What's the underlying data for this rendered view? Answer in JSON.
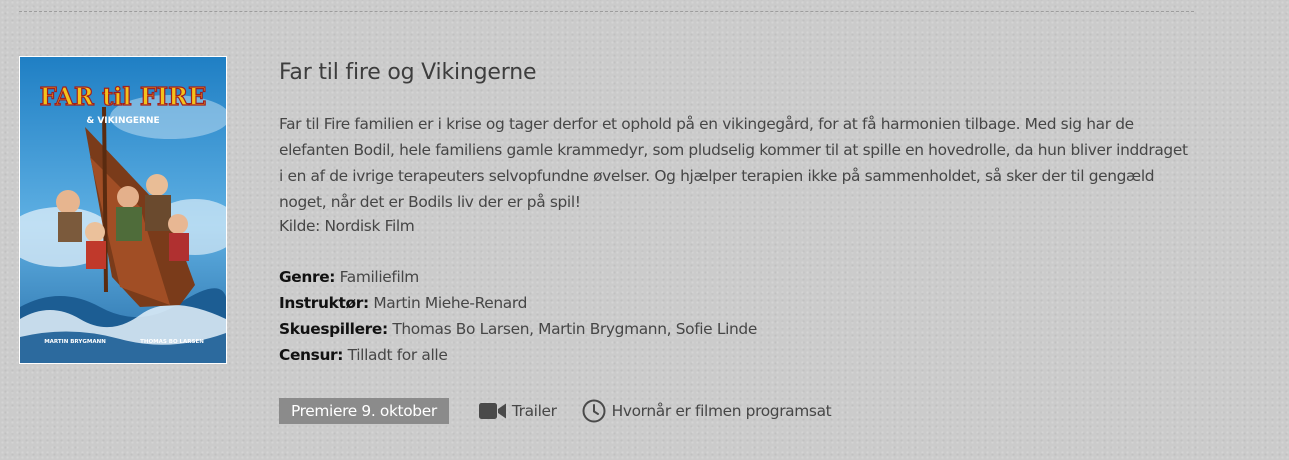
{
  "movie": {
    "title": "Far til fire og Vikingerne",
    "description": "Far til Fire familien er i krise og tager derfor et ophold på en vikingegård, for at få harmonien tilbage. Med sig har de elefanten Bodil, hele familiens gamle krammedyr, som pludselig kommer til at spille en hovedrolle, da hun bliver inddraget i en af de ivrige terapeuters selvopfundne øvelser. Og hjælper terapien ikke på sammenholdet, så sker der til gengæld noget, når det er Bodils liv der er på spil!",
    "source": "Kilde: Nordisk Film",
    "details": {
      "genre_label": "Genre:",
      "genre": "Familiefilm",
      "director_label": "Instruktør:",
      "director": "Martin Miehe-Renard",
      "actors_label": "Skuespillere:",
      "actors": "Thomas Bo Larsen, Martin Brygmann, Sofie Linde",
      "rating_label": "Censur:",
      "rating": "Tilladt for alle"
    }
  },
  "poster": {
    "title_line1": "FAR til FIRE",
    "title_line2": "& VIKINGERNE",
    "credit_left": "MARTIN BRYGMANN",
    "credit_right": "THOMAS BO LARSEN"
  },
  "actions": {
    "premiere": "Premiere 9. oktober",
    "trailer": "Trailer",
    "schedule": "Hvornår er filmen programsat"
  },
  "icons": {
    "trailer": "video-camera-icon",
    "schedule": "clock-icon"
  },
  "colors": {
    "background": "#cbcbcb",
    "premiere_badge": "#8b8b8b",
    "text": "#464646"
  }
}
